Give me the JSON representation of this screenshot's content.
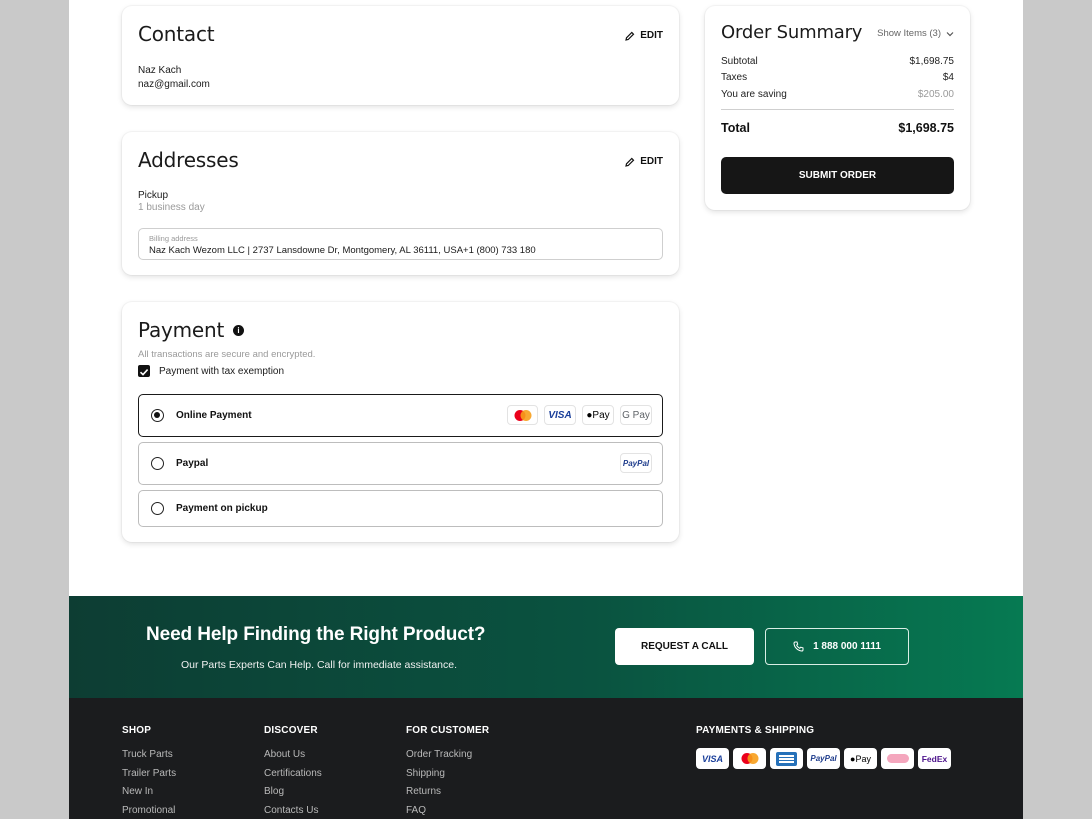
{
  "contact": {
    "title": "Contact",
    "edit": "EDIT",
    "name": "Naz Kach",
    "email": "naz@gmail.com"
  },
  "addresses": {
    "title": "Addresses",
    "edit": "EDIT",
    "method": "Pickup",
    "method_time": "1 business day",
    "billing_label": "Billing address",
    "billing_value": "Naz Kach Wezom LLC | 2737 Lansdowne Dr, Montgomery, AL 36111, USA+1 (800) 733 180"
  },
  "payment": {
    "title": "Payment",
    "secure_note": "All transactions are secure and encrypted.",
    "tax_exemption": "Payment with tax exemption",
    "options": [
      {
        "label": "Online Payment",
        "selected": true
      },
      {
        "label": "Paypal",
        "selected": false
      },
      {
        "label": "Payment on pickup",
        "selected": false
      }
    ],
    "online_logos": [
      "mastercard-icon",
      "VISA",
      "Pay",
      "G Pay"
    ],
    "paypal_logo": "PayPal"
  },
  "summary": {
    "title": "Order Summary",
    "show_items": "Show Items (3)",
    "subtotal_label": "Subtotal",
    "subtotal": "$1,698.75",
    "taxes_label": "Taxes",
    "taxes": "$4",
    "saving_label": "You are saving",
    "saving": "$205.00",
    "total_label": "Total",
    "total": "$1,698.75",
    "submit": "SUBMIT ORDER"
  },
  "help": {
    "title": "Need Help Finding the Right Product?",
    "subtitle": "Our Parts Experts Can Help. Call for immediate assistance.",
    "request_call": "REQUEST A CALL",
    "phone": "1 888 000 1111"
  },
  "footer": {
    "shop": {
      "title": "SHOP",
      "links": [
        "Truck Parts",
        "Trailer Parts",
        "New In",
        "Promotional"
      ]
    },
    "discover": {
      "title": "DISCOVER",
      "links": [
        "About Us",
        "Certifications",
        "Blog",
        "Contacts Us"
      ]
    },
    "customer": {
      "title": "FOR CUSTOMER",
      "links": [
        "Order Tracking",
        "Shipping",
        "Returns",
        "FAQ"
      ]
    },
    "payments": {
      "title": "PAYMENTS & SHIPPING",
      "badges": [
        "VISA",
        "mastercard-icon",
        "amex-icon",
        "PayPal",
        "Pay",
        "klarna-icon",
        "FedEx"
      ]
    }
  },
  "colors": {
    "accent_dark": "#161616",
    "green_start": "#0d3d33",
    "green_end": "#067a52",
    "footer_bg": "#1b1c1e"
  }
}
